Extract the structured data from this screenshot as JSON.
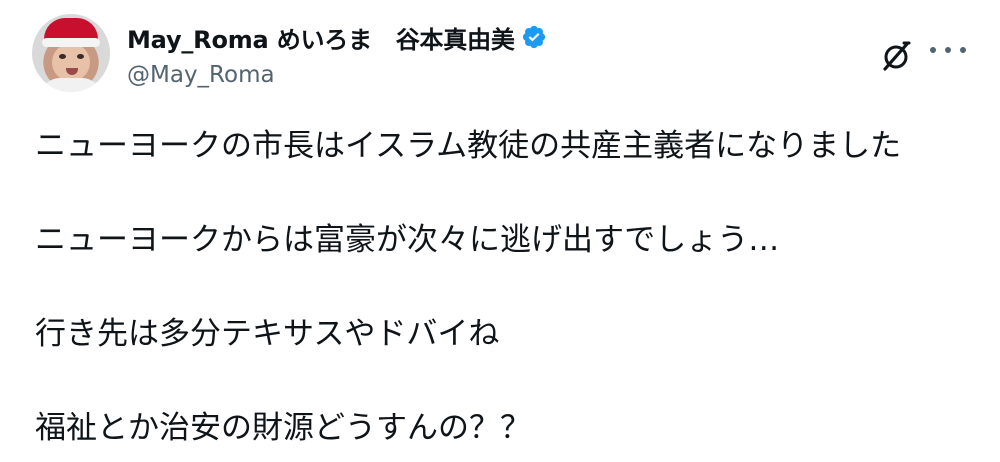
{
  "author": {
    "display_name": "May_Roma めいろま　谷本真由美",
    "handle": "@May_Roma",
    "verified": true,
    "avatar": "baby-in-santa-hat-avatar"
  },
  "actions": {
    "grok_icon": "grok-icon",
    "more_icon": "more-options-icon"
  },
  "tweet": {
    "lines": [
      "ニューヨークの市長はイスラム教徒の共産主義者になりました",
      "ニューヨークからは富豪が次々に逃げ出すでしょう…",
      "行き先は多分テキサスやドバイね",
      "福祉とか治安の財源どうすんの？？"
    ]
  },
  "colors": {
    "text": "#0f1419",
    "secondary": "#536471",
    "verified_blue": "#1d9bf0"
  }
}
